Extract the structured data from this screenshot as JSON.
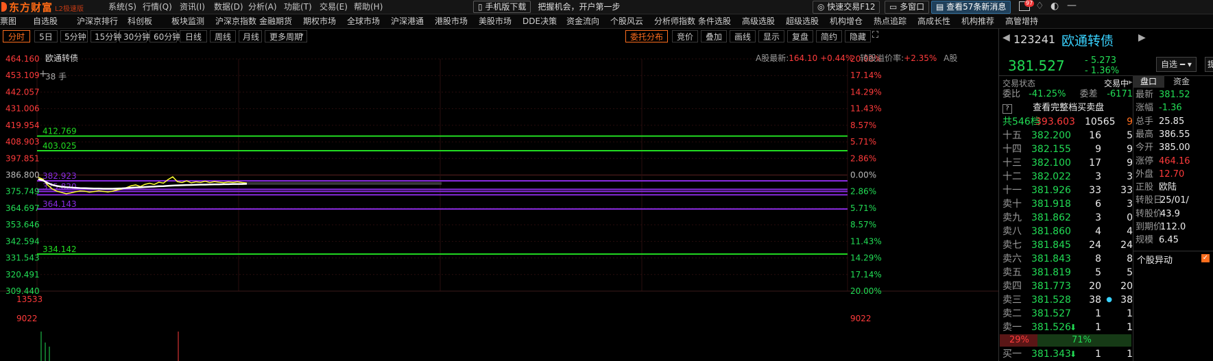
{
  "topbar": {
    "logo_name": "东方财富",
    "logo_edition": "L2极速版",
    "menu": [
      "系统(S)",
      "行情(Q)",
      "资讯(I)",
      "数据(D)",
      "分析(A)",
      "功能(T)",
      "交易(E)",
      "帮助(H)"
    ],
    "mobile_btn": "手机版下载",
    "slogan": "把握机会，开户第一步",
    "quick_trade": "快速交易F12",
    "my_window": "多窗口",
    "news_btn": "查看57条新消息",
    "badge": "97"
  },
  "navbar": {
    "items": [
      "票图",
      "自选股",
      "沪深京排行",
      "科创板",
      "板块监测",
      "沪深京指数",
      "金融期货",
      "期权市场",
      "全球市场",
      "沪深港通",
      "港股市场",
      "美股市场",
      "DDE决策",
      "资金流向",
      "个股风云",
      "分析师指数",
      "条件选股",
      "高级选股",
      "超级选股",
      "机构增仓",
      "热点追踪",
      "高成长性",
      "机构推荐",
      "高管增持"
    ]
  },
  "periodbar": {
    "buttons": [
      "分时",
      "5日",
      "5分钟",
      "15分钟",
      "30分钟",
      "60分钟",
      "日线",
      "周线",
      "月线",
      "更多周期"
    ],
    "active": "分时",
    "tools": [
      "委托分布",
      "竞价",
      "叠加",
      "画线",
      "显示",
      "复盘",
      "简约",
      "隐藏"
    ]
  },
  "chart": {
    "stock_label": "欧通转债",
    "volume_tag": "38 手",
    "a_share_price_label": "A股最新:",
    "a_share_price": "164.10",
    "a_share_pct": "+0.44%",
    "premium_label": "转股溢价率:",
    "premium": "+2.35%",
    "a_tag": "A股",
    "left_ticks": [
      "464.160",
      "453.109",
      "442.057",
      "431.006",
      "419.954",
      "408.903",
      "397.851",
      "386.800",
      "375.749",
      "364.697",
      "353.646",
      "342.594",
      "331.543",
      "320.491",
      "309.440"
    ],
    "right_ticks": [
      "20.00%",
      "17.14%",
      "14.29%",
      "11.43%",
      "8.57%",
      "5.71%",
      "2.86%",
      "0.00%",
      "2.86%",
      "5.71%",
      "8.57%",
      "11.43%",
      "14.29%",
      "17.14%",
      "20.00%"
    ],
    "right_tick_colors": [
      "#ff3b3b",
      "#ff3b3b",
      "#ff3b3b",
      "#ff3b3b",
      "#ff3b3b",
      "#ff3b3b",
      "#ff3b3b",
      "#bbbbbb",
      "#22dd55",
      "#22dd55",
      "#22dd55",
      "#22dd55",
      "#22dd55",
      "#22dd55",
      "#22dd55"
    ],
    "ref_lines": [
      {
        "label": "412.769",
        "color": "#22dd22",
        "value": 412.769
      },
      {
        "label": "403.025",
        "color": "#22dd22",
        "value": 403.025
      },
      {
        "label": "382.923",
        "color": "#8a2be2",
        "value": 382.923
      },
      {
        "label": "375.820",
        "color": "#8a2be2",
        "value": 375.82
      },
      {
        "label": "364.143",
        "color": "#8a2be2",
        "value": 364.143
      },
      {
        "label": "334.142",
        "color": "#22dd22",
        "value": 334.142
      }
    ],
    "vol_ticks": [
      "13533",
      "9022"
    ]
  },
  "chart_data": {
    "type": "line",
    "ylim": [
      309.44,
      464.16
    ],
    "series": [
      {
        "color": "#ffff33",
        "values": [
          385.2,
          384.0,
          380.1,
          377.5,
          376.0,
          375.2,
          374.3,
          374.9,
          375.6,
          376.2,
          376.0,
          375.4,
          375.8,
          376.3,
          375.9,
          375.5,
          376.0,
          376.8,
          377.5,
          378.4,
          379.6,
          380.2,
          379.1,
          380.6,
          381.3,
          380.5,
          382.0,
          381.4,
          383.8,
          385.6,
          382.4,
          381.8,
          382.9,
          381.6,
          382.3,
          381.9,
          382.6,
          381.8,
          382.4,
          382.0,
          381.7,
          382.2,
          381.9,
          382.3,
          381.8,
          381.5
        ]
      },
      {
        "color": "#ffffff",
        "values": [
          384.0,
          383.2,
          381.5,
          380.2,
          379.5,
          379.0,
          378.7,
          378.5,
          378.3,
          378.1,
          378.0,
          377.9,
          377.8,
          377.8,
          377.7,
          377.7,
          377.7,
          377.8,
          377.9,
          378.1,
          378.3,
          378.5,
          378.6,
          378.8,
          379.0,
          379.1,
          379.3,
          379.4,
          379.6,
          379.8,
          379.9,
          380.0,
          380.1,
          380.2,
          380.3,
          380.4,
          380.4,
          380.5,
          380.6,
          380.6,
          380.7,
          380.7,
          380.8,
          380.8,
          380.8,
          380.9
        ]
      }
    ]
  },
  "rpanel": {
    "code": "123241",
    "name": "欧通转债",
    "price": "381.527",
    "change": "- 5.273",
    "change_pct": "- 1.36%",
    "selfpick_btn": "自选",
    "status_label": "交易状态",
    "status_value": "交易中",
    "tabs": [
      "盘口",
      "资金"
    ],
    "ratio_label": "委比",
    "ratio_value": "-41.25%",
    "diff_label": "委差",
    "diff_value": "-6171",
    "full_book_label": "查看完整档买卖盘",
    "total_label": "共546档",
    "total_price": "393.603",
    "total_vol": "10565",
    "total_n": "9",
    "sells": [
      {
        "label": "十五",
        "price": "382.200",
        "vol": "16",
        "n": "5"
      },
      {
        "label": "十四",
        "price": "382.155",
        "vol": "9",
        "n": "9"
      },
      {
        "label": "十三",
        "price": "382.100",
        "vol": "17",
        "n": "9"
      },
      {
        "label": "十二",
        "price": "382.022",
        "vol": "3",
        "n": "3"
      },
      {
        "label": "十一",
        "price": "381.926",
        "vol": "33",
        "n": "33"
      },
      {
        "label": "卖十",
        "price": "381.918",
        "vol": "6",
        "n": "3"
      },
      {
        "label": "卖九",
        "price": "381.862",
        "vol": "3",
        "n": "0"
      },
      {
        "label": "卖八",
        "price": "381.860",
        "vol": "4",
        "n": "4"
      },
      {
        "label": "卖七",
        "price": "381.845",
        "vol": "24",
        "n": "24"
      },
      {
        "label": "卖六",
        "price": "381.843",
        "vol": "8",
        "n": "8"
      },
      {
        "label": "卖五",
        "price": "381.819",
        "vol": "5",
        "n": "5"
      },
      {
        "label": "卖四",
        "price": "381.773",
        "vol": "20",
        "n": "20"
      },
      {
        "label": "卖三",
        "price": "381.528",
        "vol": "38",
        "n": "38"
      },
      {
        "label": "卖二",
        "price": "381.527",
        "vol": "1",
        "n": "1"
      },
      {
        "label": "卖一",
        "price": "381.526",
        "vol": "1",
        "n": "1"
      }
    ],
    "split_sell": "29%",
    "split_buy": "71%",
    "buy1": {
      "label": "买一",
      "price": "381.343",
      "vol": "1",
      "n": "1"
    },
    "stats": [
      {
        "label": "最新",
        "value": "381.52",
        "color": "#22dd55"
      },
      {
        "label": "涨幅",
        "value": "-1.36",
        "color": "#22dd55"
      },
      {
        "label": "总手",
        "value": "25.85",
        "color": "#eeeeee"
      },
      {
        "label": "最高",
        "value": "386.55",
        "color": "#eeeeee"
      },
      {
        "label": "今开",
        "value": "385.00",
        "color": "#eeeeee"
      },
      {
        "label": "涨停",
        "value": "464.16",
        "color": "#ff3b3b"
      },
      {
        "label": "外盘",
        "value": "12.70",
        "color": "#ff3b3b"
      },
      {
        "label": "正股",
        "value": "欧陆",
        "color": "#eeeeee"
      },
      {
        "label": "转股日",
        "value": "25/01/",
        "color": "#eeeeee"
      },
      {
        "label": "转股价",
        "value": "43.9",
        "color": "#eeeeee"
      },
      {
        "label": "到期价",
        "value": "112.0",
        "color": "#eeeeee"
      },
      {
        "label": "规模",
        "value": "6.45",
        "color": "#eeeeee"
      }
    ],
    "movement_label": "个股异动"
  }
}
